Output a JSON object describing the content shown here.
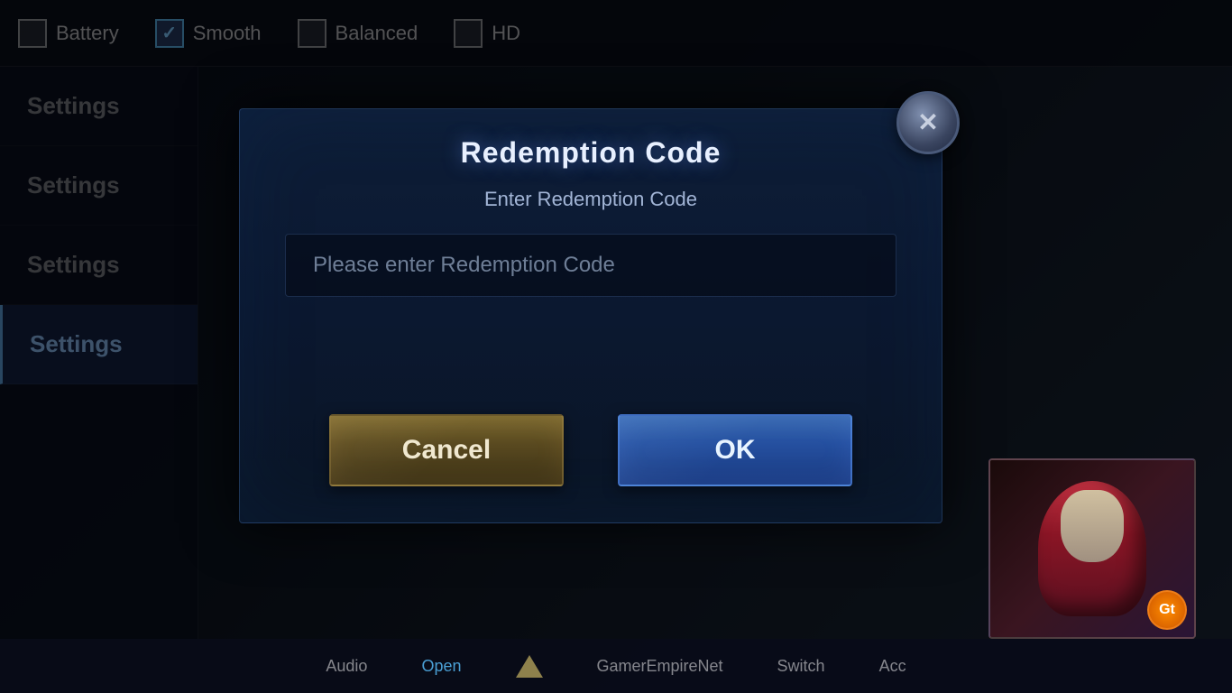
{
  "topbar": {
    "items": [
      {
        "label": "Battery",
        "checked": false
      },
      {
        "label": "Smooth",
        "checked": true
      },
      {
        "label": "Balanced",
        "checked": false
      },
      {
        "label": "HD",
        "checked": false
      }
    ]
  },
  "sidebar": {
    "items": [
      {
        "label": "Settings",
        "active": false
      },
      {
        "label": "Settings",
        "active": false
      },
      {
        "label": "Settings",
        "active": false
      },
      {
        "label": "Settings",
        "active": true
      }
    ]
  },
  "modal": {
    "title": "Redemption Code",
    "subtitle": "Enter Redemption Code",
    "input_placeholder": "Please enter Redemption Code",
    "cancel_label": "Cancel",
    "ok_label": "OK"
  },
  "bottom": {
    "audio_label": "Audio",
    "open_label": "Open",
    "site_label": "GamerEmpireNet",
    "switch_label": "Switch",
    "acc_label": "Acc"
  },
  "thumbnail": {
    "badge_text": "Gt"
  }
}
